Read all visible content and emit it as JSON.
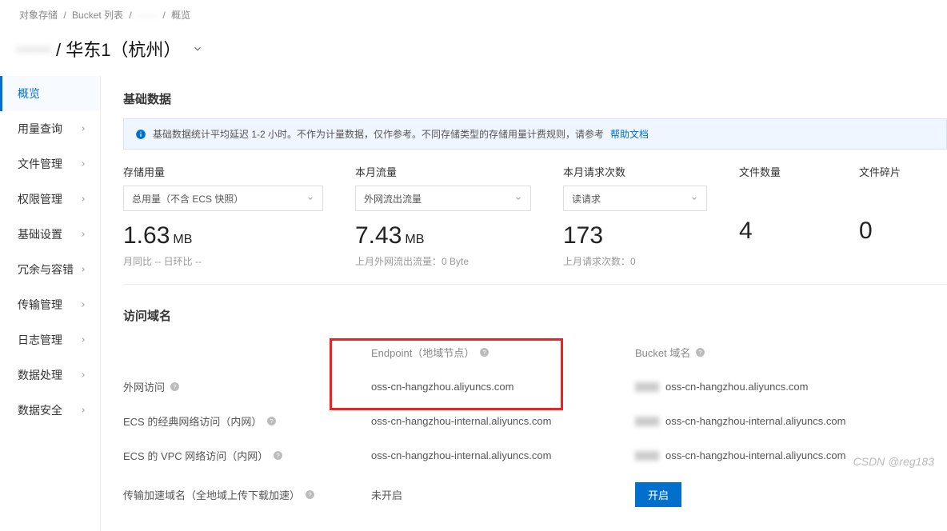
{
  "breadcrumb": {
    "a": "对象存储",
    "b": "Bucket 列表",
    "c": "······",
    "d": "概览"
  },
  "title": {
    "prefix": "······",
    "region": "/ 华东1（杭州）"
  },
  "sidebar": [
    {
      "label": "概览",
      "active": true,
      "arrow": false
    },
    {
      "label": "用量查询",
      "active": false,
      "arrow": true
    },
    {
      "label": "文件管理",
      "active": false,
      "arrow": true
    },
    {
      "label": "权限管理",
      "active": false,
      "arrow": true
    },
    {
      "label": "基础设置",
      "active": false,
      "arrow": true
    },
    {
      "label": "冗余与容错",
      "active": false,
      "arrow": true
    },
    {
      "label": "传输管理",
      "active": false,
      "arrow": true
    },
    {
      "label": "日志管理",
      "active": false,
      "arrow": true
    },
    {
      "label": "数据处理",
      "active": false,
      "arrow": true
    },
    {
      "label": "数据安全",
      "active": false,
      "arrow": true
    }
  ],
  "section1_title": "基础数据",
  "banner": {
    "text": "基础数据统计平均延迟 1-2 小时。不作为计量数据，仅作参考。不同存储类型的存储用量计费规则，请参考",
    "link": "帮助文档"
  },
  "metrics": {
    "storage": {
      "label": "存储用量",
      "select": "总用量（不含 ECS 快照）",
      "value": "1.63",
      "unit": "MB",
      "sub": "月同比 --  日环比 --"
    },
    "traffic": {
      "label": "本月流量",
      "select": "外网流出流量",
      "value": "7.43",
      "unit": "MB",
      "sub": "上月外网流出流量：0 Byte"
    },
    "requests": {
      "label": "本月请求次数",
      "select": "读请求",
      "value": "173",
      "sub": "上月请求次数：0"
    },
    "files": {
      "label": "文件数量",
      "value": "4"
    },
    "fragments": {
      "label": "文件碎片",
      "value": "0"
    }
  },
  "section2_title": "访问域名",
  "table": {
    "head": {
      "endpoint": "Endpoint（地域节点）",
      "bucket": "Bucket 域名"
    },
    "rows": [
      {
        "name": "外网访问",
        "endpoint": "oss-cn-hangzhou.aliyuncs.com",
        "bucket": "oss-cn-hangzhou.aliyuncs.com",
        "help": true,
        "blur": true
      },
      {
        "name": "ECS 的经典网络访问（内网）",
        "endpoint": "oss-cn-hangzhou-internal.aliyuncs.com",
        "bucket": "oss-cn-hangzhou-internal.aliyuncs.com",
        "help": true,
        "blur": true
      },
      {
        "name": "ECS 的 VPC 网络访问（内网）",
        "endpoint": "oss-cn-hangzhou-internal.aliyuncs.com",
        "bucket": "oss-cn-hangzhou-internal.aliyuncs.com",
        "help": true,
        "blur": true
      }
    ],
    "accel": {
      "name": "传输加速域名（全地域上传下载加速）",
      "status": "未开启",
      "btn": "开启"
    }
  },
  "watermark": "CSDN @reg183"
}
